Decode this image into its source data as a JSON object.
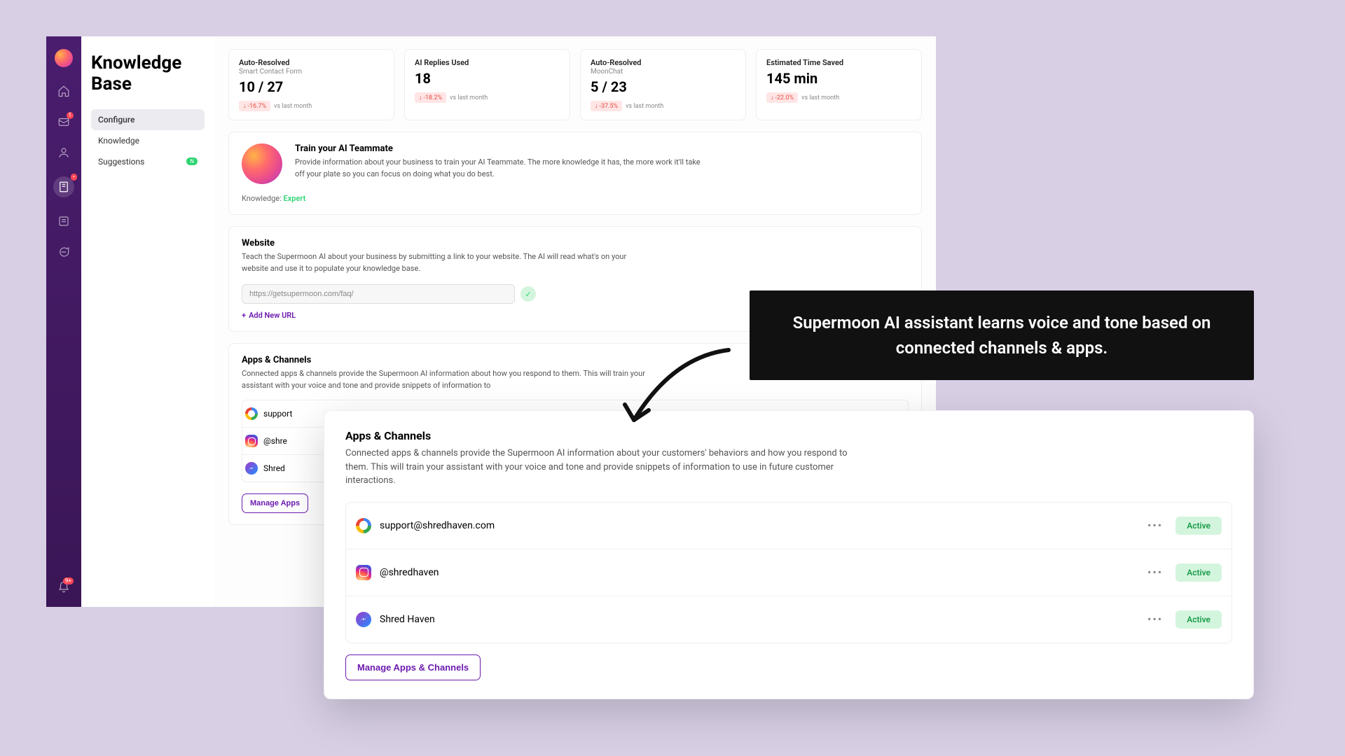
{
  "page": {
    "title": "Knowledge Base"
  },
  "subnav": {
    "configure": "Configure",
    "knowledge": "Knowledge",
    "suggestions": "Suggestions"
  },
  "stats": {
    "card1": {
      "label": "Auto-Resolved",
      "sub": "Smart Contact Form",
      "value": "10 / 27",
      "delta": "-16.7%",
      "suffix": "vs last month"
    },
    "card2": {
      "label": "AI Replies Used",
      "value": "18",
      "delta": "-18.2%",
      "suffix": "vs last month"
    },
    "card3": {
      "label": "Auto-Resolved",
      "sub": "MoonChat",
      "value": "5 / 23",
      "delta": "-37.5%",
      "suffix": "vs last month"
    },
    "card4": {
      "label": "Estimated Time Saved",
      "value": "145 min",
      "delta": "-22.0%",
      "suffix": "vs last month"
    }
  },
  "train": {
    "title": "Train your AI Teammate",
    "desc": "Provide information about your business to train your AI Teammate. The more knowledge it has, the more work it'll take off your plate so you can focus on doing what you do best.",
    "knowledge_label": "Knowledge:",
    "knowledge_value": "Expert"
  },
  "website": {
    "title": "Website",
    "desc": "Teach the Supermoon AI about your business by submitting a link to your website. The AI will read what's on your website and use it to populate your knowledge base.",
    "url": "https://getsupermoon.com/faq/",
    "add_url": "Add New URL"
  },
  "apps_bg": {
    "title": "Apps & Channels",
    "desc_partial": "Connected apps & channels provide the Supermoon AI information about how you respond to them. This will train your assistant with your voice and tone and provide snippets of information to",
    "row1": "support",
    "row2": "@shre",
    "row3": "Shred",
    "manage": "Manage Apps"
  },
  "apps": {
    "title": "Apps & Channels",
    "desc": "Connected apps & channels provide the Supermoon AI information about your customers' behaviors and how you respond to them. This will train your assistant with your voice and tone and provide snippets of information to use in future customer interactions.",
    "channels": [
      {
        "name": "support@shredhaven.com",
        "status": "Active",
        "icon": "google"
      },
      {
        "name": "@shredhaven",
        "status": "Active",
        "icon": "instagram"
      },
      {
        "name": "Shred Haven",
        "status": "Active",
        "icon": "messenger"
      }
    ],
    "manage_btn": "Manage Apps & Channels"
  },
  "callout": "Supermoon AI assistant learns voice and tone based on connected channels & apps."
}
